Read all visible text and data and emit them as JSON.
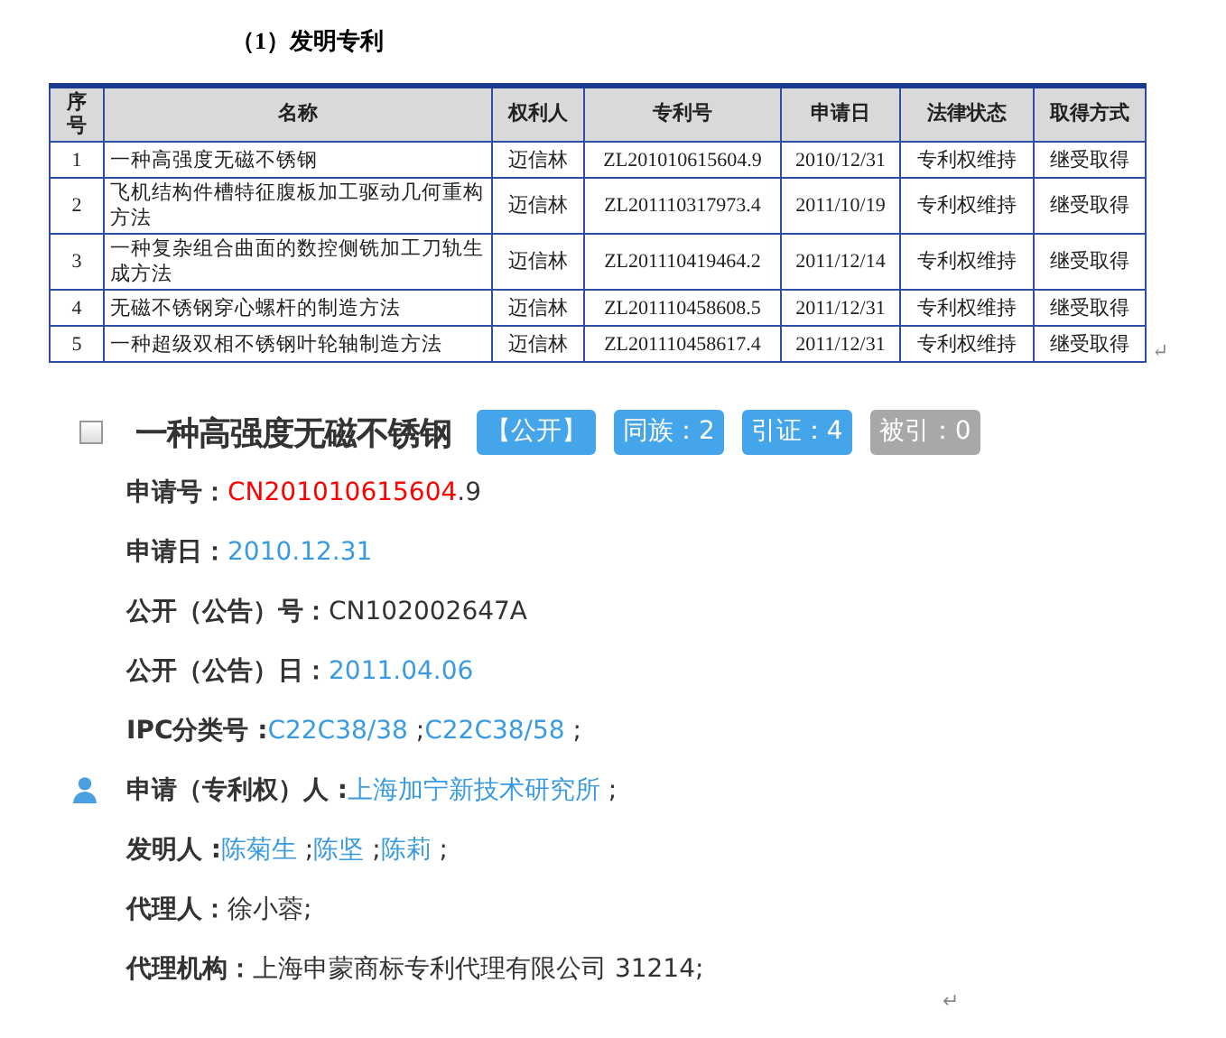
{
  "heading": "（1）发明专利",
  "table": {
    "columns": [
      "序号",
      "名称",
      "权利人",
      "专利号",
      "申请日",
      "法律状态",
      "取得方式"
    ],
    "rows": [
      [
        "1",
        "一种高强度无磁不锈钢",
        "迈信林",
        "ZL201010615604.9",
        "2010/12/31",
        "专利权维持",
        "继受取得"
      ],
      [
        "2",
        "飞机结构件槽特征腹板加工驱动几何重构方法",
        "迈信林",
        "ZL201110317973.4",
        "2011/10/19",
        "专利权维持",
        "继受取得"
      ],
      [
        "3",
        "一种复杂组合曲面的数控侧铣加工刀轨生成方法",
        "迈信林",
        "ZL201110419464.2",
        "2011/12/14",
        "专利权维持",
        "继受取得"
      ],
      [
        "4",
        "无磁不锈钢穿心螺杆的制造方法",
        "迈信林",
        "ZL201110458608.5",
        "2011/12/31",
        "专利权维持",
        "继受取得"
      ],
      [
        "5",
        "一种超级双相不锈钢叶轮轴制造方法",
        "迈信林",
        "ZL201110458617.4",
        "2011/12/31",
        "专利权维持",
        "继受取得"
      ]
    ],
    "end_mark": "↵"
  },
  "patent": {
    "checked": false,
    "title": "一种高强度无磁不锈钢",
    "badges": [
      {
        "label": "【公开】",
        "disabled": false
      },
      {
        "label": "同族：2",
        "disabled": false
      },
      {
        "label": "引证：4",
        "disabled": false
      },
      {
        "label": "被引：0",
        "disabled": true
      }
    ],
    "fields": [
      {
        "label": "申请号：",
        "icon": false,
        "parts": [
          {
            "text": "CN201010615604",
            "kind": "red"
          },
          {
            "text": ".9",
            "kind": "plain"
          }
        ]
      },
      {
        "label": "申请日：",
        "icon": false,
        "parts": [
          {
            "text": "2010.12.31",
            "kind": "link"
          }
        ]
      },
      {
        "label": "公开（公告）号：",
        "icon": false,
        "parts": [
          {
            "text": "CN102002647A",
            "kind": "plain"
          }
        ]
      },
      {
        "label": "公开（公告）日：",
        "icon": false,
        "parts": [
          {
            "text": "2011.04.06",
            "kind": "link"
          }
        ]
      },
      {
        "label": "IPC分类号 :",
        "icon": false,
        "parts": [
          {
            "text": "C22C38/38",
            "kind": "link"
          },
          {
            "text": " ;",
            "kind": "plain"
          },
          {
            "text": "C22C38/58",
            "kind": "link"
          },
          {
            "text": " ;",
            "kind": "plain"
          }
        ]
      },
      {
        "label": "申请（专利权）人 :",
        "icon": true,
        "parts": [
          {
            "text": "上海加宁新技术研究所",
            "kind": "link"
          },
          {
            "text": " ;",
            "kind": "plain"
          }
        ]
      },
      {
        "label": "发明人 :",
        "icon": false,
        "parts": [
          {
            "text": "陈菊生",
            "kind": "link"
          },
          {
            "text": " ;",
            "kind": "plain"
          },
          {
            "text": "陈坚",
            "kind": "link"
          },
          {
            "text": " ;",
            "kind": "plain"
          },
          {
            "text": "陈莉",
            "kind": "link"
          },
          {
            "text": " ;",
            "kind": "plain"
          }
        ]
      },
      {
        "label": "代理人：",
        "icon": false,
        "parts": [
          {
            "text": "徐小蓉;",
            "kind": "plain"
          }
        ]
      },
      {
        "label": "代理机构：",
        "icon": false,
        "parts": [
          {
            "text": "上海申蒙商标专利代理有限公司 31214;",
            "kind": "plain"
          }
        ]
      }
    ],
    "end_mark": "↵"
  }
}
